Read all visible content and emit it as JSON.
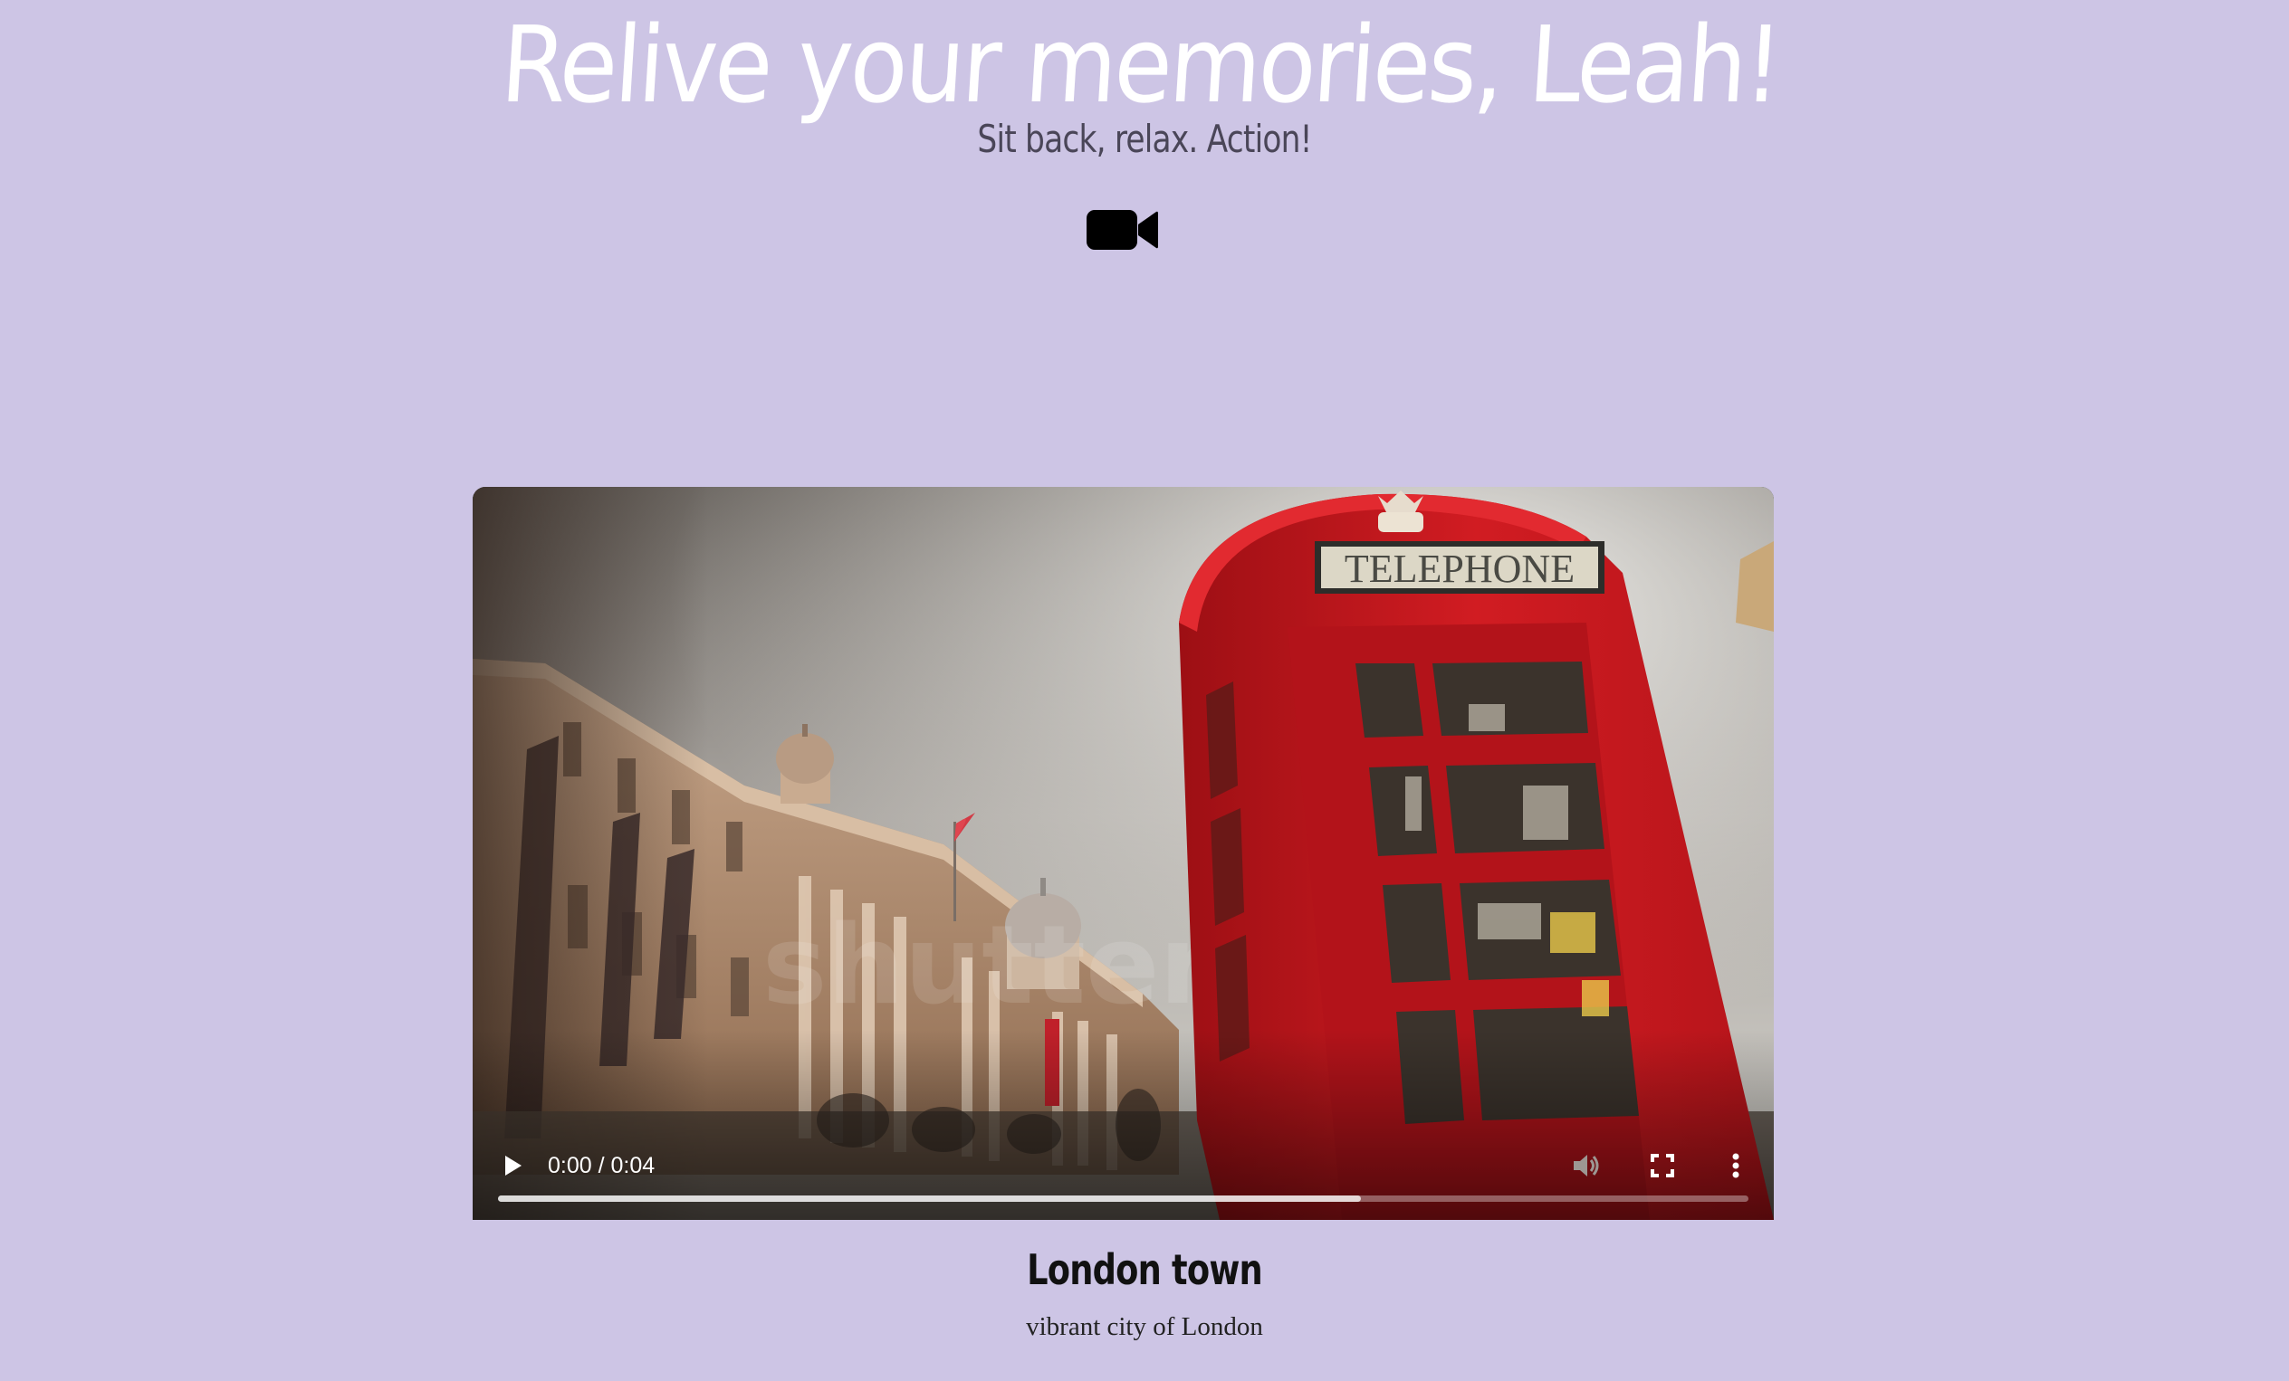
{
  "header": {
    "title": "Relive your memories, Leah!",
    "subtitle": "Sit back, relax. Action!",
    "icon": "video-camera-icon"
  },
  "video": {
    "sign_text": "TELEPHONE",
    "time_display": "0:00 / 0:04",
    "current_time": "0:00",
    "duration": "0:04",
    "buffered_fraction": 0.69,
    "controls": {
      "play_icon": "play-icon",
      "mute_icon": "volume-icon",
      "fullscreen_icon": "fullscreen-icon",
      "more_icon": "more-vertical-icon"
    },
    "caption_title": "London town",
    "caption_description": "vibrant city of London"
  },
  "colors": {
    "background": "#cdc5e5",
    "title": "#ffffff",
    "booth_red": "#c8161d"
  }
}
